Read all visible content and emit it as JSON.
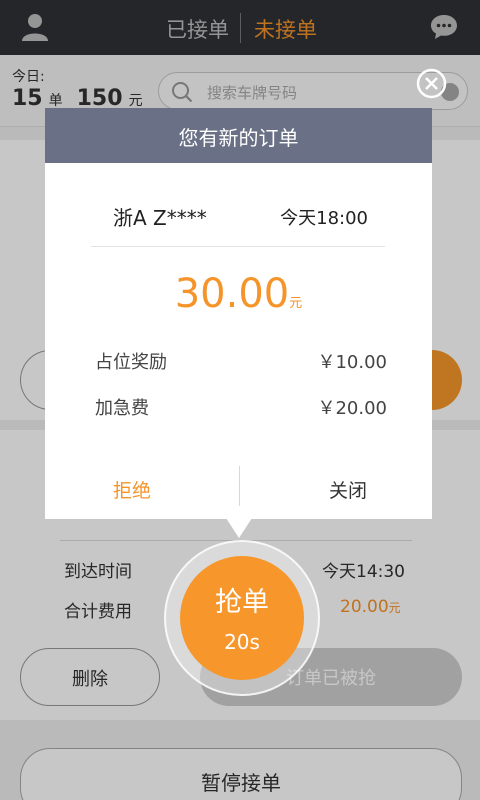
{
  "header": {
    "tab_accepted": "已接单",
    "tab_unaccepted": "未接单"
  },
  "stats": {
    "today_label": "今日:",
    "orders_count": "15",
    "orders_unit": "单",
    "amount": "150",
    "amount_unit": "元"
  },
  "search": {
    "placeholder": "搜索车牌号码"
  },
  "background_order": {
    "arrival_label": "到达时间",
    "arrival_value": "今天14:30",
    "total_label": "合计费用",
    "total_value": "20.00",
    "total_unit": "元",
    "delete_label": "删除",
    "grabbed_label": "订单已被抢",
    "pause_label": "暂停接单"
  },
  "grab": {
    "label": "抢单",
    "countdown": "20s"
  },
  "dialog": {
    "title": "您有新的订单",
    "plate": "浙A Z****",
    "time": "今天18:00",
    "amount": "30.00",
    "amount_unit": "元",
    "fees": [
      {
        "label": "占位奖励",
        "value": "￥10.00"
      },
      {
        "label": "加急费",
        "value": "￥20.00"
      }
    ],
    "reject_label": "拒绝",
    "close_label": "关闭"
  },
  "colors": {
    "accent": "#f5942a",
    "header_bar": "#2f3136",
    "dialog_header": "#6a7086"
  }
}
